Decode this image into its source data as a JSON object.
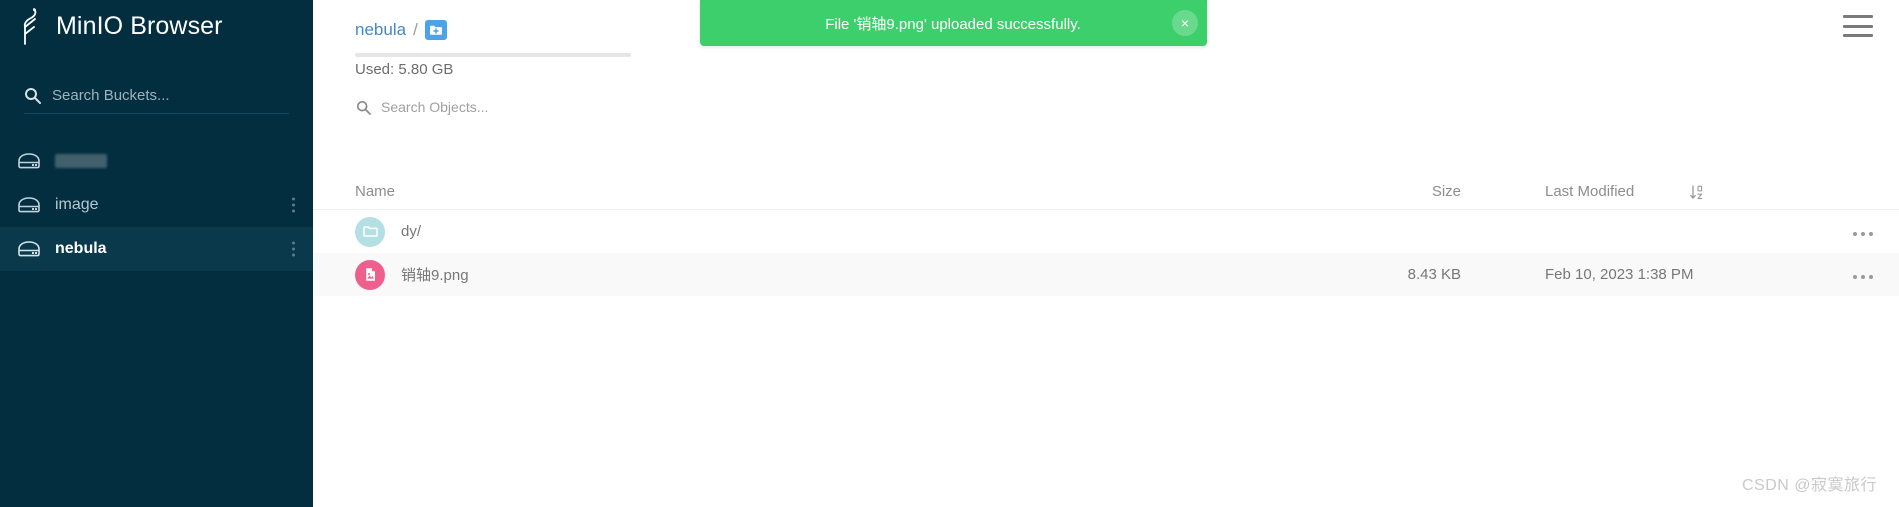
{
  "sidebar": {
    "brand_title": "MinIO Browser",
    "logo_icon": "minio-bird-logo",
    "search": {
      "icon": "search-icon",
      "placeholder": "Search Buckets...",
      "value": ""
    },
    "buckets": [
      {
        "label": "",
        "icon": "bucket-icon",
        "redacted": true,
        "active": false,
        "menu_icon": "vertical-dots-icon"
      },
      {
        "label": "image",
        "icon": "bucket-icon",
        "redacted": false,
        "active": false,
        "menu_icon": "vertical-dots-icon"
      },
      {
        "label": "nebula",
        "icon": "bucket-icon",
        "redacted": false,
        "active": true,
        "menu_icon": "vertical-dots-icon"
      }
    ]
  },
  "header": {
    "menu_icon": "hamburger-menu-icon",
    "breadcrumb": {
      "bucket": "nebula",
      "separator": "/",
      "add_folder_icon": "folder-plus-icon"
    }
  },
  "usage": {
    "text": "Used: 5.80 GB",
    "bar_percent": 0
  },
  "object_search": {
    "icon": "search-icon",
    "placeholder": "Search Objects...",
    "value": ""
  },
  "toast": {
    "message": "File '销轴9.png' uploaded successfully.",
    "close_label": "×",
    "color": "#3ecf6d"
  },
  "table": {
    "columns": {
      "name": "Name",
      "size": "Size",
      "last_modified": "Last Modified",
      "sort_icon": "sort-descending-icon"
    },
    "rows": [
      {
        "name": "dy/",
        "size": "",
        "last_modified": "",
        "icon": "folder-icon",
        "badge_color": "#b4dfe3",
        "type": "folder",
        "menu_icon": "horizontal-dots-icon",
        "striped": false
      },
      {
        "name": "销轴9.png",
        "size": "8.43 KB",
        "last_modified": "Feb 10, 2023 1:38 PM",
        "icon": "image-file-icon",
        "badge_color": "#ef5f8d",
        "type": "file",
        "menu_icon": "horizontal-dots-icon",
        "striped": true
      }
    ]
  },
  "watermark": {
    "text": "CSDN @寂寞旅行"
  }
}
